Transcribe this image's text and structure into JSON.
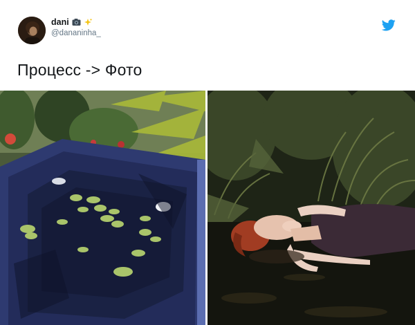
{
  "tweet": {
    "display_name": "dani",
    "handle": "@dananinha_",
    "text": "Процесс -> Фото",
    "emoji": [
      "camera-emoji",
      "sparkles-emoji"
    ],
    "brand_color": "#1da1f2"
  },
  "media": {
    "images": [
      {
        "label": "process-photo"
      },
      {
        "label": "final-photo"
      }
    ]
  },
  "icons": {
    "logo": "twitter-bird-icon"
  }
}
